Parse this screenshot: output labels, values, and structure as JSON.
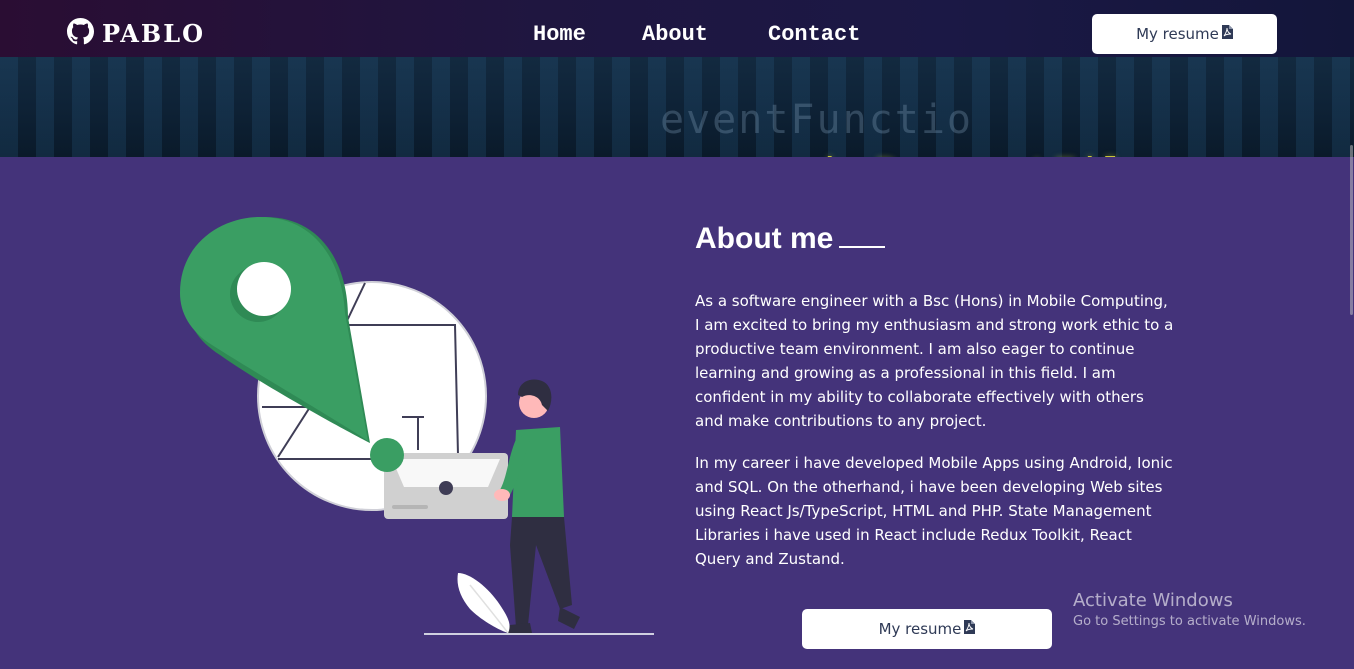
{
  "brand": {
    "name": "PABLO",
    "icon": "github-icon"
  },
  "nav": {
    "items": [
      {
        "label": "Home"
      },
      {
        "label": "About"
      },
      {
        "label": "Contact"
      }
    ],
    "resume_label": "My resume"
  },
  "banner": {
    "code_top": "eventFunctio",
    "code_main": "maybeRequestFilesys"
  },
  "about": {
    "title": "About me",
    "paragraphs": [
      "As a software engineer with a Bsc (Hons) in Mobile Computing, I am excited to bring my enthusiasm and strong work ethic to a productive team environment. I am also eager to continue learning and growing as a professional in this field. I am confident in my ability to collaborate effectively with others and make contributions to any project.",
      "In my career i have developed Mobile Apps using Android, Ionic and SQL. On the otherhand, i have been developing Web sites using React Js/TypeScript, HTML and PHP. State Management Libraries i have used in React include Redux Toolkit, React Query and Zustand."
    ],
    "resume_label": "My resume"
  },
  "watermark": {
    "title": "Activate Windows",
    "subtitle": "Go to Settings to activate Windows."
  },
  "colors": {
    "background": "#44337a",
    "navbar": "#1f1640",
    "accent_green": "#3a9e63",
    "button_bg": "#ffffff",
    "button_text": "#2f3a56"
  },
  "icons": [
    "github-icon",
    "pdf-icon"
  ]
}
